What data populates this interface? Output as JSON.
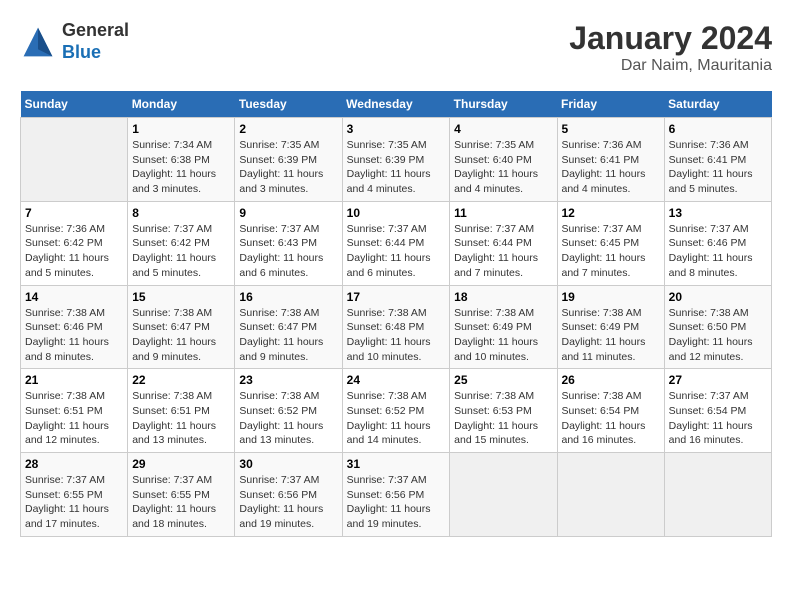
{
  "logo": {
    "general": "General",
    "blue": "Blue"
  },
  "title": "January 2024",
  "subtitle": "Dar Naim, Mauritania",
  "days_of_week": [
    "Sunday",
    "Monday",
    "Tuesday",
    "Wednesday",
    "Thursday",
    "Friday",
    "Saturday"
  ],
  "weeks": [
    [
      {
        "day": "",
        "info": ""
      },
      {
        "day": "1",
        "info": "Sunrise: 7:34 AM\nSunset: 6:38 PM\nDaylight: 11 hours\nand 3 minutes."
      },
      {
        "day": "2",
        "info": "Sunrise: 7:35 AM\nSunset: 6:39 PM\nDaylight: 11 hours\nand 3 minutes."
      },
      {
        "day": "3",
        "info": "Sunrise: 7:35 AM\nSunset: 6:39 PM\nDaylight: 11 hours\nand 4 minutes."
      },
      {
        "day": "4",
        "info": "Sunrise: 7:35 AM\nSunset: 6:40 PM\nDaylight: 11 hours\nand 4 minutes."
      },
      {
        "day": "5",
        "info": "Sunrise: 7:36 AM\nSunset: 6:41 PM\nDaylight: 11 hours\nand 4 minutes."
      },
      {
        "day": "6",
        "info": "Sunrise: 7:36 AM\nSunset: 6:41 PM\nDaylight: 11 hours\nand 5 minutes."
      }
    ],
    [
      {
        "day": "7",
        "info": "Sunrise: 7:36 AM\nSunset: 6:42 PM\nDaylight: 11 hours\nand 5 minutes."
      },
      {
        "day": "8",
        "info": "Sunrise: 7:37 AM\nSunset: 6:42 PM\nDaylight: 11 hours\nand 5 minutes."
      },
      {
        "day": "9",
        "info": "Sunrise: 7:37 AM\nSunset: 6:43 PM\nDaylight: 11 hours\nand 6 minutes."
      },
      {
        "day": "10",
        "info": "Sunrise: 7:37 AM\nSunset: 6:44 PM\nDaylight: 11 hours\nand 6 minutes."
      },
      {
        "day": "11",
        "info": "Sunrise: 7:37 AM\nSunset: 6:44 PM\nDaylight: 11 hours\nand 7 minutes."
      },
      {
        "day": "12",
        "info": "Sunrise: 7:37 AM\nSunset: 6:45 PM\nDaylight: 11 hours\nand 7 minutes."
      },
      {
        "day": "13",
        "info": "Sunrise: 7:37 AM\nSunset: 6:46 PM\nDaylight: 11 hours\nand 8 minutes."
      }
    ],
    [
      {
        "day": "14",
        "info": "Sunrise: 7:38 AM\nSunset: 6:46 PM\nDaylight: 11 hours\nand 8 minutes."
      },
      {
        "day": "15",
        "info": "Sunrise: 7:38 AM\nSunset: 6:47 PM\nDaylight: 11 hours\nand 9 minutes."
      },
      {
        "day": "16",
        "info": "Sunrise: 7:38 AM\nSunset: 6:47 PM\nDaylight: 11 hours\nand 9 minutes."
      },
      {
        "day": "17",
        "info": "Sunrise: 7:38 AM\nSunset: 6:48 PM\nDaylight: 11 hours\nand 10 minutes."
      },
      {
        "day": "18",
        "info": "Sunrise: 7:38 AM\nSunset: 6:49 PM\nDaylight: 11 hours\nand 10 minutes."
      },
      {
        "day": "19",
        "info": "Sunrise: 7:38 AM\nSunset: 6:49 PM\nDaylight: 11 hours\nand 11 minutes."
      },
      {
        "day": "20",
        "info": "Sunrise: 7:38 AM\nSunset: 6:50 PM\nDaylight: 11 hours\nand 12 minutes."
      }
    ],
    [
      {
        "day": "21",
        "info": "Sunrise: 7:38 AM\nSunset: 6:51 PM\nDaylight: 11 hours\nand 12 minutes."
      },
      {
        "day": "22",
        "info": "Sunrise: 7:38 AM\nSunset: 6:51 PM\nDaylight: 11 hours\nand 13 minutes."
      },
      {
        "day": "23",
        "info": "Sunrise: 7:38 AM\nSunset: 6:52 PM\nDaylight: 11 hours\nand 13 minutes."
      },
      {
        "day": "24",
        "info": "Sunrise: 7:38 AM\nSunset: 6:52 PM\nDaylight: 11 hours\nand 14 minutes."
      },
      {
        "day": "25",
        "info": "Sunrise: 7:38 AM\nSunset: 6:53 PM\nDaylight: 11 hours\nand 15 minutes."
      },
      {
        "day": "26",
        "info": "Sunrise: 7:38 AM\nSunset: 6:54 PM\nDaylight: 11 hours\nand 16 minutes."
      },
      {
        "day": "27",
        "info": "Sunrise: 7:37 AM\nSunset: 6:54 PM\nDaylight: 11 hours\nand 16 minutes."
      }
    ],
    [
      {
        "day": "28",
        "info": "Sunrise: 7:37 AM\nSunset: 6:55 PM\nDaylight: 11 hours\nand 17 minutes."
      },
      {
        "day": "29",
        "info": "Sunrise: 7:37 AM\nSunset: 6:55 PM\nDaylight: 11 hours\nand 18 minutes."
      },
      {
        "day": "30",
        "info": "Sunrise: 7:37 AM\nSunset: 6:56 PM\nDaylight: 11 hours\nand 19 minutes."
      },
      {
        "day": "31",
        "info": "Sunrise: 7:37 AM\nSunset: 6:56 PM\nDaylight: 11 hours\nand 19 minutes."
      },
      {
        "day": "",
        "info": ""
      },
      {
        "day": "",
        "info": ""
      },
      {
        "day": "",
        "info": ""
      }
    ]
  ]
}
